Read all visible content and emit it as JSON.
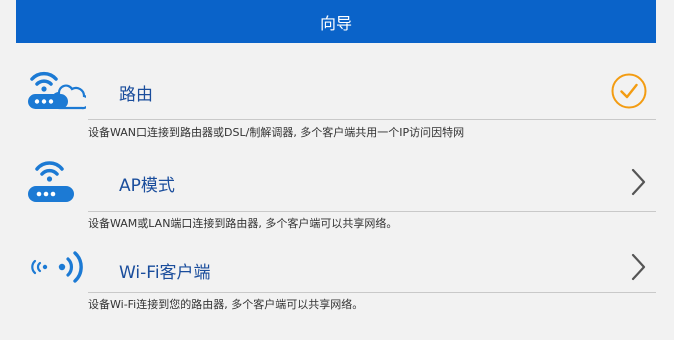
{
  "header": {
    "title": "向导"
  },
  "colors": {
    "header_bg": "#0a63c9",
    "accent_blue": "#1c7ad4",
    "selected_orange": "#f39c12",
    "title_text": "#1a4d9c"
  },
  "modes": [
    {
      "title": "路由",
      "description": "设备WAN口连接到路由器或DSL/制解调器, 多个客户端共用一个IP访问因特网",
      "icon": "router-cloud-icon",
      "state_icon": "check-circle-icon",
      "selected": true
    },
    {
      "title": "AP模式",
      "description": "设备WAM或LAN端口连接到路由器, 多个客户端可以共享网络。",
      "icon": "access-point-icon",
      "state_icon": "chevron-right-icon",
      "selected": false
    },
    {
      "title": "Wi-Fi客户端",
      "description": "设备Wi-Fi连接到您的路由器, 多个客户端可以共享网络。",
      "icon": "wifi-signal-icon",
      "state_icon": "chevron-right-icon",
      "selected": false
    }
  ]
}
